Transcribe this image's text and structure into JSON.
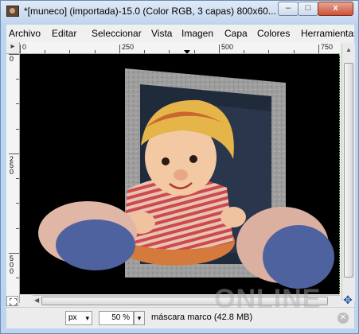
{
  "window": {
    "title": "*[muneco] (importada)-15.0 (Color RGB, 3 capas) 800x60...",
    "minimize_glyph": "–",
    "maximize_glyph": "□",
    "close_glyph": "x"
  },
  "menu": [
    "Archivo",
    "Editar",
    "Seleccionar",
    "Vista",
    "Imagen",
    "Capa",
    "Colores",
    "Herramientas"
  ],
  "ruler": {
    "corner_glyph": "▸",
    "h_labels": [
      "0",
      "250",
      "500",
      "750"
    ],
    "v_labels": [
      "0",
      "2 5 0",
      "5 0 0"
    ]
  },
  "statusbar": {
    "unit": "px",
    "zoom": "50 %",
    "layer_status": "máscara marco (42.8 MB)"
  },
  "watermark": "ONLINE",
  "colors": {
    "canvas_bg": "#000000",
    "frame_gray": "#9a9a9a",
    "doll_shirt": "#c85050",
    "doll_shoes": "#4f62a0"
  }
}
